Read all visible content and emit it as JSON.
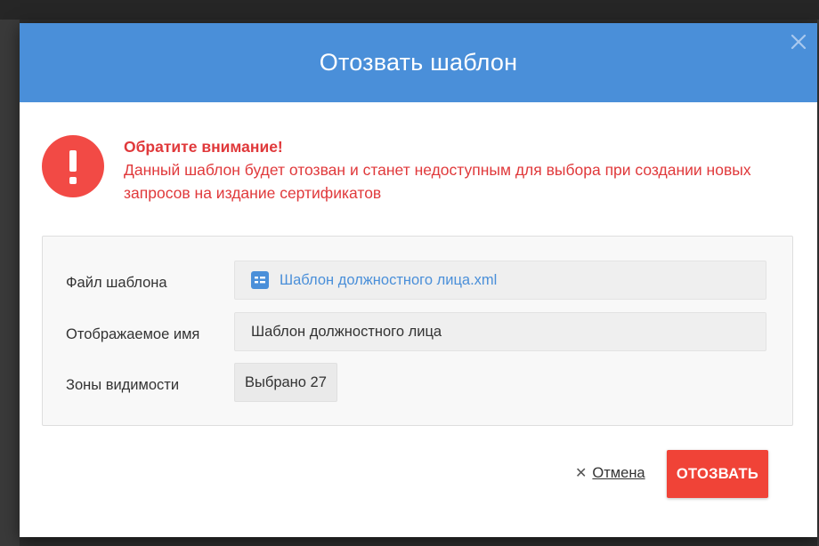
{
  "colors": {
    "header": "#4a8fd9",
    "warning": "#e0393b",
    "primary_button": "#f04337",
    "link": "#4a8fd9"
  },
  "dialog": {
    "title": "Отозвать шаблон",
    "close_icon": "close-icon",
    "warning": {
      "icon": "exclamation-circle-icon",
      "title": "Обратите внимание!",
      "message": "Данный шаблон будет отозван и станет недоступным для выбора при создании новых запросов на издание сертификатов"
    },
    "fields": {
      "template_file": {
        "label": "Файл шаблона",
        "value": "Шаблон должностного лица.xml",
        "icon": "file-list-icon"
      },
      "display_name": {
        "label": "Отображаемое имя",
        "value": "Шаблон должностного лица"
      },
      "visibility_zones": {
        "label": "Зоны видимости",
        "value": "Выбрано 27"
      }
    },
    "footer": {
      "cancel_label": "Отмена",
      "cancel_icon": "close-small-icon",
      "revoke_label": "ОТОЗВАТЬ"
    }
  }
}
